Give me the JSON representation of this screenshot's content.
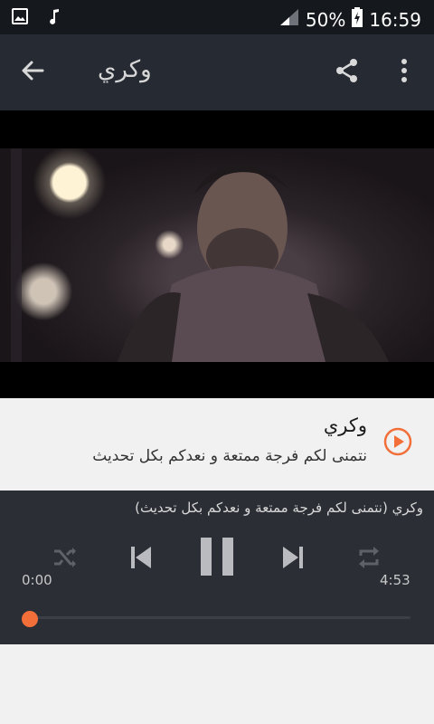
{
  "status_bar": {
    "battery": "50%",
    "time": "16:59"
  },
  "app_bar": {
    "title": "وكري"
  },
  "song": {
    "title": "وكري",
    "subtitle": "نتمنى لكم فرجة ممتعة و نعدكم بكل تحديث"
  },
  "player": {
    "now_playing": "وكري (نتمنى لكم فرجة ممتعة و نعدكم بكل تحديث)",
    "elapsed": "0:00",
    "duration": "4:53",
    "progress": 0.0
  },
  "colors": {
    "accent": "#f36f39",
    "app_bar": "#262a33",
    "player_bg": "#2b2e35"
  }
}
